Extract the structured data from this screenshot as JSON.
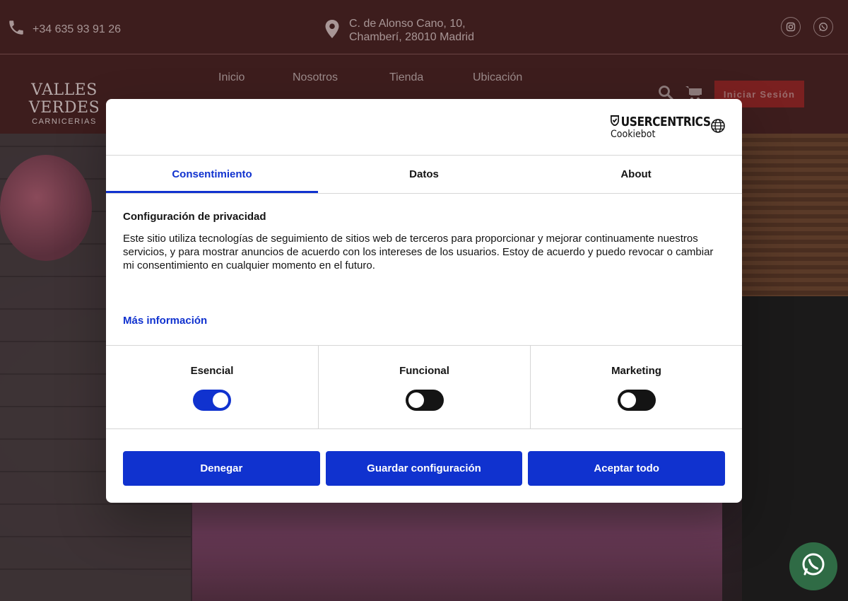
{
  "site": {
    "phone": "+34 635 93 91 26",
    "address_line1": "C. de Alonso Cano, 10,",
    "address_line2": "Chamberí, 28010 Madrid",
    "logo_name": "VALLES VERDES",
    "logo_sub": "CARNICERIAS",
    "menu": [
      "Inicio",
      "Nosotros",
      "Tienda",
      "Ubicación"
    ],
    "login_label": "Iniciar Sesión",
    "icons": [
      "phone-icon",
      "location-pin-icon",
      "instagram-icon",
      "whatsapp-icon",
      "search-icon",
      "cart-icon",
      "whatsapp-float-icon"
    ]
  },
  "dialog": {
    "brand_top": "USERCENTRICS",
    "brand_bottom": "Cookiebot",
    "tabs": [
      "Consentimiento",
      "Datos",
      "About"
    ],
    "active_tab": "Consentimiento",
    "heading": "Configuración de privacidad",
    "body": "Este sitio utiliza tecnologías de seguimiento de sitios web de terceros para proporcionar y mejorar continuamente nuestros servicios, y para mostrar anuncios de acuerdo con los intereses de los usuarios. Estoy de acuerdo y puedo revocar o cambiar mi consentimiento en cualquier momento en el futuro.",
    "more_link": "Más información",
    "toggles": [
      {
        "label": "Esencial",
        "on": true
      },
      {
        "label": "Funcional",
        "on": false
      },
      {
        "label": "Marketing",
        "on": false
      }
    ],
    "buttons": {
      "deny": "Denegar",
      "save": "Guardar configuración",
      "accept": "Aceptar todo"
    }
  },
  "colors": {
    "accent": "#1032cf",
    "header_bg": "#3d1d1d",
    "login_bg": "#7a2020"
  }
}
